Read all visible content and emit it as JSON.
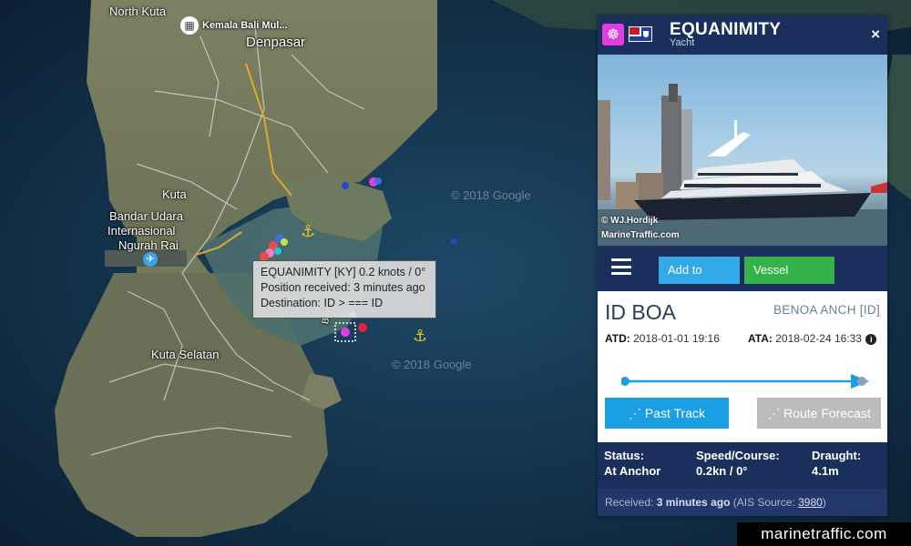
{
  "map": {
    "labels": {
      "north_kuta": "North Kuta",
      "poi": "Kemala Bali Mul...",
      "denpasar": "Denpasar",
      "kuta": "Kuta",
      "airport_line1": "Bandar Udara",
      "airport_line2": "Internasional",
      "airport_line3": "Ngurah Rai",
      "kuta_selatan": "Kuta Selatan",
      "bay": "Bay"
    },
    "watermarks": [
      "© 2018 Google",
      "© 2018 Google"
    ],
    "tooltip": {
      "line1": "EQUANIMITY [KY] 0.2 knots / 0°",
      "line2": "Position received: 3 minutes ago",
      "line3": "Destination: ID > === ID"
    }
  },
  "vessel": {
    "name": "EQUANIMITY",
    "type": "Yacht",
    "close_label": "×",
    "photo_credit_1": "© WJ.Hordijk",
    "photo_credit_2": "MarineTraffic.com"
  },
  "toolbar": {
    "add_to_fleet": "Add to Fleet",
    "vessel_details": "Vessel Details"
  },
  "voyage": {
    "destination": "ID BOA",
    "anchorage": "BENOA ANCH [ID]",
    "atd_label": "ATD:",
    "atd_value": "2018-01-01 19:16",
    "ata_label": "ATA:",
    "ata_value": "2018-02-24 16:33",
    "progress_fraction": 1.0,
    "past_track": "Past Track",
    "route_forecast": "Route Forecast"
  },
  "status": {
    "status_label": "Status:",
    "status_value": "At Anchor",
    "speed_label": "Speed/Course:",
    "speed_value": "0.2kn / 0°",
    "draught_label": "Draught:",
    "draught_value": "4.1m"
  },
  "received": {
    "prefix": "Received:",
    "time": "3 minutes ago",
    "source_prefix": "(AIS Source:",
    "source_id": "3980",
    "source_suffix": ")"
  },
  "brand": "marinetraffic.com",
  "colors": {
    "header_navy": "#1a2f5c",
    "accent_blue": "#34a9e7",
    "accent_green": "#35b34a",
    "vessel_magenta": "#e23de2"
  }
}
